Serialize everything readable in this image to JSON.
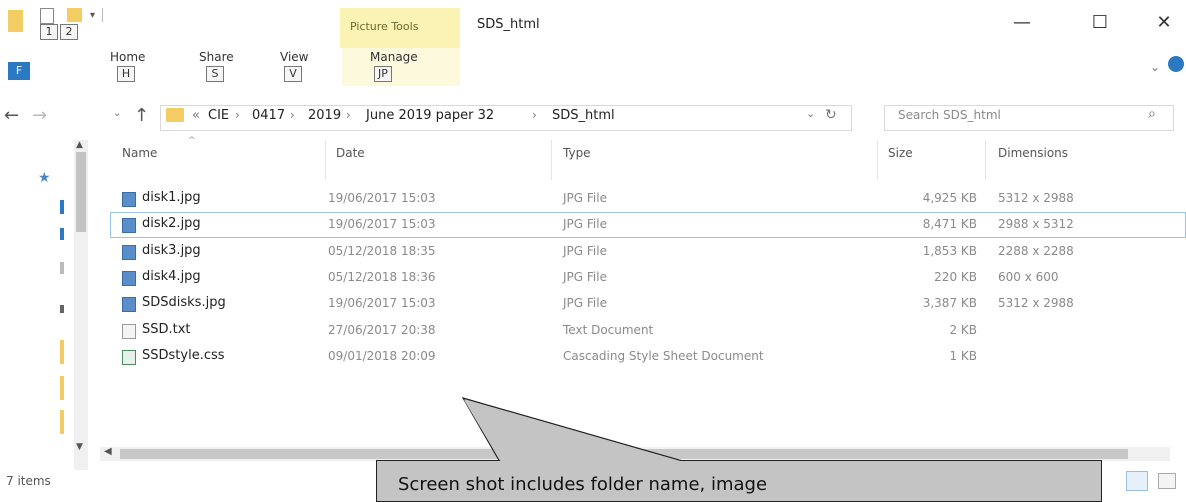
{
  "titlebar": {
    "keytips": [
      "1",
      "2"
    ],
    "picture_tools_label": "Picture Tools",
    "window_title": "SDS_html",
    "minimize_glyph": "—",
    "maximize_glyph": "☐",
    "close_glyph": "✕"
  },
  "ribbon": {
    "file_keytip": "F",
    "tabs": [
      {
        "label": "Home",
        "keytip": "H"
      },
      {
        "label": "Share",
        "keytip": "S"
      },
      {
        "label": "View",
        "keytip": "V"
      },
      {
        "label": "Manage",
        "keytip": "JP"
      }
    ]
  },
  "address": {
    "overflow": "«",
    "crumbs": [
      "CIE",
      "0417",
      "2019",
      "June 2019 paper 32",
      "SDS_html"
    ],
    "separator": "›"
  },
  "search": {
    "placeholder": "Search SDS_html"
  },
  "columns": [
    "Name",
    "Date",
    "Type",
    "Size",
    "Dimensions"
  ],
  "files": [
    {
      "name": "disk1.jpg",
      "date": "19/06/2017 15:03",
      "type": "JPG File",
      "size": "4,925 KB",
      "dimensions": "5312 x 2988",
      "icon": "image-file-icon"
    },
    {
      "name": "disk2.jpg",
      "date": "19/06/2017 15:03",
      "type": "JPG File",
      "size": "8,471 KB",
      "dimensions": "2988 x 5312",
      "icon": "image-file-icon"
    },
    {
      "name": "disk3.jpg",
      "date": "05/12/2018 18:35",
      "type": "JPG File",
      "size": "1,853 KB",
      "dimensions": "2288 x 2288",
      "icon": "image-file-icon"
    },
    {
      "name": "disk4.jpg",
      "date": "05/12/2018 18:36",
      "type": "JPG File",
      "size": "220 KB",
      "dimensions": "600 x 600",
      "icon": "image-file-icon"
    },
    {
      "name": "SDSdisks.jpg",
      "date": "19/06/2017 15:03",
      "type": "JPG File",
      "size": "3,387 KB",
      "dimensions": "5312 x 2988",
      "icon": "image-file-icon"
    },
    {
      "name": "SSD.txt",
      "date": "27/06/2017 20:38",
      "type": "Text Document",
      "size": "2 KB",
      "dimensions": "",
      "icon": "text-file-icon"
    },
    {
      "name": "SSDstyle.css",
      "date": "09/01/2018 20:09",
      "type": "Cascading Style Sheet Document",
      "size": "1 KB",
      "dimensions": "",
      "icon": "css-file-icon"
    }
  ],
  "status": {
    "item_count": "7 items"
  },
  "callout": {
    "text": "Screen shot includes folder name, image"
  },
  "colors": {
    "accent": "#2b79c2",
    "picture_tools": "#faf3b4",
    "callout_fill": "#c4c4c4"
  }
}
